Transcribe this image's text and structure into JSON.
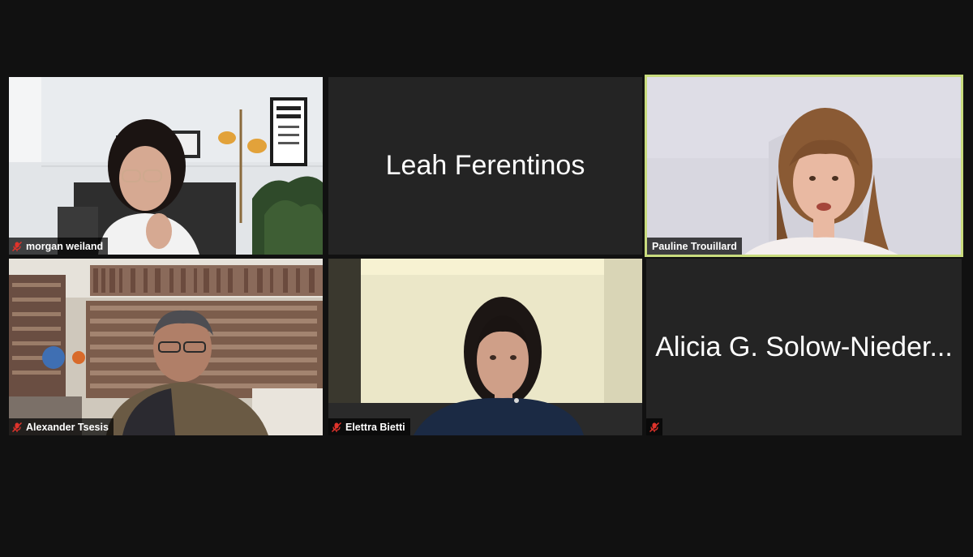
{
  "app": {
    "background_color": "#111111",
    "tile_color": "#242424",
    "active_speaker_border_color": "#c9dc7e",
    "muted_icon_color": "#e0332b"
  },
  "participants": [
    {
      "name": "morgan weiland",
      "muted": true,
      "video": true
    },
    {
      "name": "Leah Ferentinos",
      "muted": false,
      "video": false
    },
    {
      "name": "Pauline Trouillard",
      "muted": false,
      "video": true,
      "active_speaker": true
    },
    {
      "name": "Alexander Tsesis",
      "muted": true,
      "video": true
    },
    {
      "name": "Elettra Bietti",
      "muted": true,
      "video": true
    },
    {
      "name": "Alicia G. Solow-Nieder...",
      "muted": true,
      "video": false
    }
  ],
  "icons": {
    "mute": "mic-off-icon"
  }
}
